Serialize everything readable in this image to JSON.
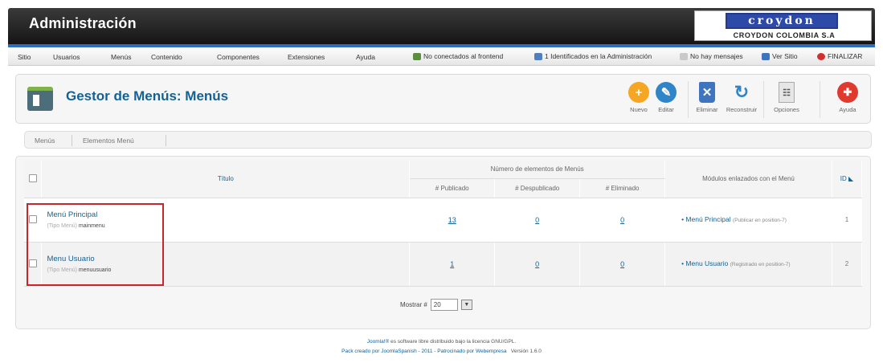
{
  "header": {
    "title": "Administración",
    "logo": {
      "word": "croydon",
      "sub": "CROYDON COLOMBIA S.A"
    }
  },
  "menubar": {
    "items": [
      "Sitio",
      "Usuarios",
      "Menús",
      "Contenido",
      "Componentes",
      "Extensiones",
      "Ayuda"
    ],
    "status": {
      "frontend": "No conectados al frontend",
      "admin": "1 Identificados en la Administración",
      "messages": "No hay mensajes",
      "view_site": "Ver Sitio",
      "logout": "FINALIZAR"
    }
  },
  "toolbar": {
    "page_title": "Gestor de Menús: Menús",
    "buttons": {
      "new": "Nuevo",
      "edit": "Editar",
      "delete": "Eliminar",
      "rebuild": "Reconstruir",
      "options": "Opciones",
      "help": "Ayuda"
    }
  },
  "submenu": {
    "menus": "Menús",
    "items": "Elementos Menú"
  },
  "table": {
    "headers": {
      "title": "Título",
      "items_group": "Número de elementos de Menús",
      "published": "# Publicado",
      "unpublished": "# Despublicado",
      "trashed": "# Eliminado",
      "modules": "Módulos enlazados con el Menú",
      "id": "ID"
    },
    "rows": [
      {
        "title": "Menú Principal",
        "type_label": "(Tipo Menú)",
        "type_value": "mainmenu",
        "published": "13",
        "unpublished": "0",
        "trashed": "0",
        "module": "Menú Principal",
        "module_info": "(Publicar en position-7)",
        "id": "1"
      },
      {
        "title": "Menu Usuario",
        "type_label": "(Tipo Menú)",
        "type_value": "menuusuario",
        "published": "1",
        "unpublished": "0",
        "trashed": "0",
        "module": "Menu Usuario",
        "module_info": "(Registrado en position-7)",
        "id": "2"
      }
    ]
  },
  "pager": {
    "label": "Mostrar #",
    "value": "20"
  },
  "footer": {
    "line1_brand": "Joomla!®",
    "line1_rest": "es software libre distribuido bajo la licencia GNU/GPL.",
    "line2": "Pack creado por JoomlaSpanish - 2011 - Patrocinado por Webempresa",
    "version": "Versión 1.6.0"
  },
  "colors": {
    "accent": "#146295",
    "header": "#1f1f1f",
    "stripe": "#2f6dbf",
    "highlight": "#c8262e"
  }
}
